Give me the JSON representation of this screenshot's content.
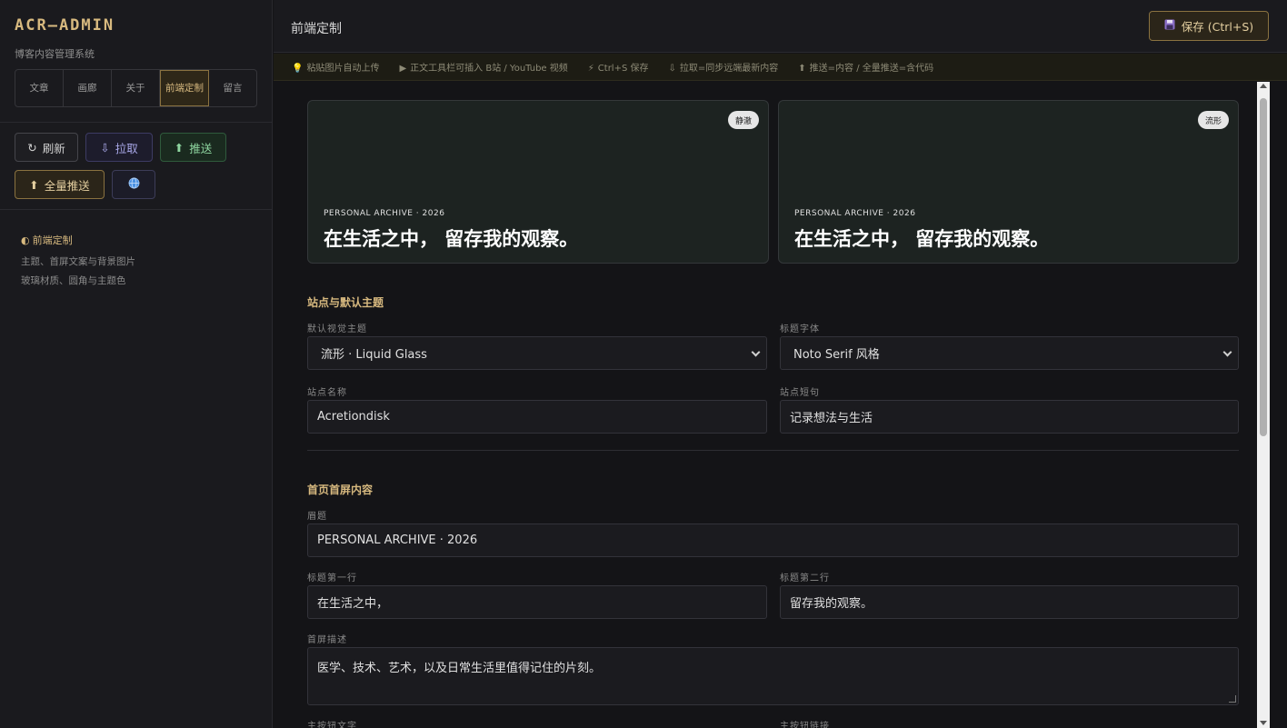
{
  "sidebar": {
    "brand": "ACR—ADMIN",
    "subtitle": "博客内容管理系统",
    "tabs": [
      {
        "label": "文章"
      },
      {
        "label": "画廊"
      },
      {
        "label": "关于"
      },
      {
        "label": "前端定制"
      },
      {
        "label": "留言"
      }
    ],
    "actions": {
      "refresh": "刷新",
      "pull": "拉取",
      "push": "推送",
      "full_push": "全量推送"
    },
    "section": {
      "title": "前端定制",
      "desc1": "主题、首屏文案与背景图片",
      "desc2": "玻璃材质、圆角与主题色"
    }
  },
  "header": {
    "title": "前端定制",
    "save_label": "保存 (Ctrl+S)"
  },
  "tips": [
    {
      "icon": "💡",
      "text": "粘贴图片自动上传"
    },
    {
      "icon": "▶",
      "text": "正文工具栏可插入 B站 / YouTube 视频"
    },
    {
      "icon": "⚡",
      "text": "Ctrl+S 保存"
    },
    {
      "icon": "⇩",
      "text": "拉取=同步远端最新内容"
    },
    {
      "icon": "⬆",
      "text": "推送=内容 / 全量推送=含代码"
    }
  ],
  "previews": [
    {
      "badge": "静澈",
      "eyebrow": "PERSONAL ARCHIVE · 2026",
      "headline": "在生活之中， 留存我的观察。"
    },
    {
      "badge": "流形",
      "eyebrow": "PERSONAL ARCHIVE · 2026",
      "headline": "在生活之中， 留存我的观察。"
    }
  ],
  "site_section": {
    "title": "站点与默认主题",
    "theme_label": "默认视觉主题",
    "theme_value": "流形 · Liquid Glass",
    "font_label": "标题字体",
    "font_value": "Noto Serif 风格",
    "name_label": "站点名称",
    "name_value": "Acretiondisk",
    "tagline_label": "站点短句",
    "tagline_value": "记录想法与生活"
  },
  "hero_section": {
    "title": "首页首屏内容",
    "eyebrow_label": "眉题",
    "eyebrow_value": "PERSONAL ARCHIVE · 2026",
    "line1_label": "标题第一行",
    "line1_value": "在生活之中，",
    "line2_label": "标题第二行",
    "line2_value": "留存我的观察。",
    "desc_label": "首屏描述",
    "desc_value": "医学、技术、艺术，以及日常生活里值得记住的片刻。",
    "btn_text_label": "主按钮文字",
    "btn_link_label": "主按钮链接"
  },
  "colors": {
    "accent": "#d7b97f",
    "background": "#141417",
    "sidebar": "#1a1a1e"
  }
}
